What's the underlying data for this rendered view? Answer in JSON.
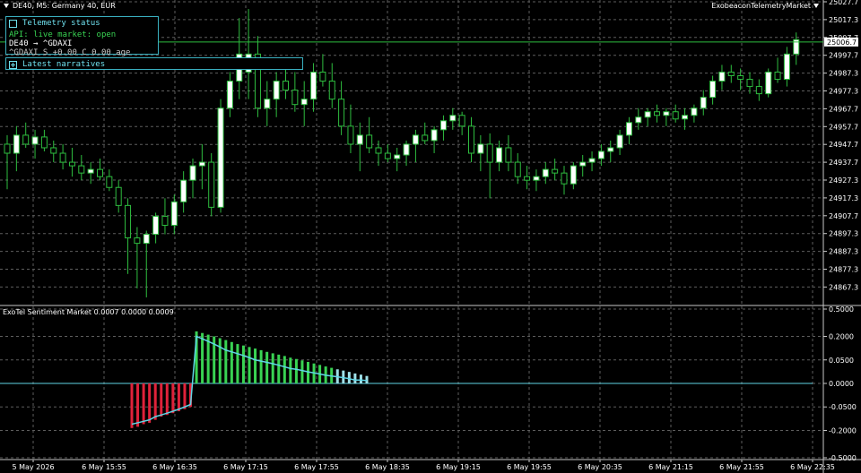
{
  "header": {
    "symbol_info": "DE40, M5:  Germany 40, EUR",
    "indicator_name": "ExobeaconTelemetryMarket"
  },
  "status_panel": {
    "title": "Telemetry status",
    "api_line": "API: live  market: open",
    "symbol_line": "DE40 → ^GDAXI",
    "quote_line": "^GDAXI S +0.00  C 0.00  age 5h49m"
  },
  "narratives_panel": {
    "title": "Latest narratives"
  },
  "price_axis": {
    "ticks": [
      "25027.7",
      "25017.3",
      "25007.7",
      "24997.7",
      "24987.3",
      "24977.3",
      "24967.7",
      "24957.7",
      "24947.7",
      "24937.7",
      "24927.3",
      "24917.3",
      "24907.7",
      "24897.3",
      "24887.3",
      "24877.3",
      "24867.3"
    ],
    "current_price": "25006.7"
  },
  "indicator": {
    "label": "ExoTel Sentiment Market 0.0007 0.0000 0.0009",
    "ticks": [
      "0.5000",
      "0.2000",
      "0.0500",
      "0.0000",
      "-0.0500",
      "-0.2000",
      "-0.5000"
    ]
  },
  "time_axis": {
    "labels": [
      "5 May 2026",
      "6 May 15:55",
      "6 May 16:35",
      "6 May 17:15",
      "6 May 17:55",
      "6 May 18:35",
      "6 May 19:15",
      "6 May 19:55",
      "6 May 20:35",
      "6 May 21:15",
      "6 May 21:55",
      "6 May 22:35"
    ]
  },
  "colors": {
    "bull_body": "#ffffff",
    "bear_body": "#000000",
    "wick": "#2ebd3f",
    "grid": "#5e5e5e",
    "hist_pos": "#39d353",
    "hist_neg": "#e0223a",
    "hist_pale": "#9fe0e8",
    "signal_line": "#5fd6e6",
    "price_line": "#2ebd3f"
  },
  "chart_data": [
    {
      "type": "candlestick",
      "title": "DE40, M5:  Germany 40, EUR",
      "ylim": [
        24862.0,
        25030.0
      ],
      "current_price": 25006.7,
      "candles": [
        [
          24950,
          24955,
          24925,
          24945
        ],
        [
          24945,
          24960,
          24935,
          24955
        ],
        [
          24955,
          24962,
          24948,
          24950
        ],
        [
          24950,
          24958,
          24942,
          24954
        ],
        [
          24954,
          24958,
          24946,
          24948
        ],
        [
          24948,
          24952,
          24940,
          24945
        ],
        [
          24945,
          24950,
          24936,
          24940
        ],
        [
          24940,
          24948,
          24932,
          24938
        ],
        [
          24938,
          24944,
          24930,
          24934
        ],
        [
          24934,
          24940,
          24928,
          24936
        ],
        [
          24936,
          24942,
          24930,
          24932
        ],
        [
          24932,
          24936,
          24924,
          24926
        ],
        [
          24926,
          24930,
          24912,
          24916
        ],
        [
          24916,
          24920,
          24878,
          24898
        ],
        [
          24898,
          24904,
          24870,
          24895
        ],
        [
          24895,
          24902,
          24865,
          24900
        ],
        [
          24900,
          24912,
          24895,
          24910
        ],
        [
          24910,
          24920,
          24900,
          24905
        ],
        [
          24905,
          24922,
          24900,
          24918
        ],
        [
          24918,
          24935,
          24912,
          24930
        ],
        [
          24930,
          24942,
          24920,
          24938
        ],
        [
          24938,
          24950,
          24925,
          24940
        ],
        [
          24940,
          24945,
          24910,
          24915
        ],
        [
          24915,
          24975,
          24912,
          24970
        ],
        [
          24970,
          24990,
          24965,
          24985
        ],
        [
          24985,
          25020,
          24975,
          25000
        ],
        [
          24990,
          25025,
          24975,
          25000
        ],
        [
          25000,
          25010,
          24965,
          24970
        ],
        [
          24970,
          24985,
          24960,
          24975
        ],
        [
          24975,
          24990,
          24965,
          24985
        ],
        [
          24985,
          24995,
          24975,
          24980
        ],
        [
          24980,
          24990,
          24968,
          24972
        ],
        [
          24972,
          24985,
          24960,
          24975
        ],
        [
          24975,
          24995,
          24968,
          24990
        ],
        [
          24990,
          25000,
          24982,
          24985
        ],
        [
          24985,
          24995,
          24970,
          24975
        ],
        [
          24975,
          24985,
          24955,
          24960
        ],
        [
          24960,
          24972,
          24945,
          24950
        ],
        [
          24950,
          24962,
          24935,
          24955
        ],
        [
          24955,
          24965,
          24945,
          24948
        ],
        [
          24948,
          24952,
          24938,
          24945
        ],
        [
          24945,
          24950,
          24940,
          24942
        ],
        [
          24942,
          24948,
          24935,
          24944
        ],
        [
          24944,
          24952,
          24938,
          24950
        ],
        [
          24950,
          24958,
          24940,
          24955
        ],
        [
          24955,
          24962,
          24950,
          24952
        ],
        [
          24952,
          24960,
          24945,
          24958
        ],
        [
          24958,
          24966,
          24952,
          24963
        ],
        [
          24963,
          24970,
          24958,
          24966
        ],
        [
          24966,
          24968,
          24955,
          24960
        ],
        [
          24960,
          24965,
          24940,
          24945
        ],
        [
          24945,
          24955,
          24935,
          24950
        ],
        [
          24950,
          24956,
          24920,
          24940
        ],
        [
          24940,
          24952,
          24935,
          24948
        ],
        [
          24948,
          24955,
          24935,
          24940
        ],
        [
          24940,
          24945,
          24928,
          24932
        ],
        [
          24932,
          24938,
          24925,
          24930
        ],
        [
          24930,
          24936,
          24924,
          24932
        ],
        [
          24932,
          24940,
          24928,
          24936
        ],
        [
          24936,
          24942,
          24930,
          24934
        ],
        [
          24934,
          24938,
          24922,
          24928
        ],
        [
          24928,
          24940,
          24925,
          24938
        ],
        [
          24938,
          24944,
          24932,
          24940
        ],
        [
          24940,
          24946,
          24935,
          24942
        ],
        [
          24942,
          24950,
          24938,
          24946
        ],
        [
          24946,
          24952,
          24940,
          24948
        ],
        [
          24948,
          24958,
          24944,
          24955
        ],
        [
          24955,
          24965,
          24950,
          24962
        ],
        [
          24962,
          24970,
          24958,
          24965
        ],
        [
          24965,
          24970,
          24960,
          24968
        ],
        [
          24968,
          24972,
          24962,
          24966
        ],
        [
          24966,
          24970,
          24960,
          24968
        ],
        [
          24968,
          24972,
          24962,
          24964
        ],
        [
          24964,
          24970,
          24958,
          24966
        ],
        [
          24966,
          24972,
          24962,
          24970
        ],
        [
          24970,
          24980,
          24966,
          24976
        ],
        [
          24976,
          24988,
          24972,
          24985
        ],
        [
          24985,
          24994,
          24980,
          24990
        ],
        [
          24990,
          24994,
          24984,
          24988
        ],
        [
          24988,
          24992,
          24980,
          24986
        ],
        [
          24986,
          24990,
          24978,
          24982
        ],
        [
          24982,
          24986,
          24974,
          24978
        ],
        [
          24978,
          24992,
          24976,
          24990
        ],
        [
          24990,
          24998,
          24984,
          24986
        ],
        [
          24986,
          25004,
          24982,
          25000
        ],
        [
          25000,
          25012,
          24994,
          25008
        ]
      ]
    },
    {
      "type": "bar",
      "title": "ExoTel Sentiment Market 0.0007 0.0000 0.0009",
      "ylim": [
        -0.5,
        0.5
      ],
      "values": [
        -0.18,
        -0.17,
        -0.15,
        -0.14,
        -0.12,
        -0.1,
        -0.09,
        -0.08,
        -0.07,
        -0.06,
        -0.05,
        0.245,
        0.23,
        0.215,
        0.2,
        0.185,
        0.17,
        0.155,
        0.14,
        0.13,
        0.12,
        0.11,
        0.1,
        0.09,
        0.082,
        0.075,
        0.068,
        0.06,
        0.054,
        0.048,
        0.042,
        0.036,
        0.031,
        0.026,
        0.022,
        0.018,
        0.015,
        0.012,
        0.009,
        0.007,
        0.005
      ],
      "signal": [
        -0.15,
        -0.14,
        -0.13,
        -0.12,
        -0.1,
        -0.09,
        -0.08,
        -0.07,
        -0.06,
        -0.05,
        -0.04,
        0.2,
        0.18,
        0.16,
        0.14,
        0.12,
        0.1,
        0.09,
        0.08,
        0.07,
        0.06,
        0.05,
        0.045,
        0.04,
        0.035,
        0.03,
        0.025,
        0.02,
        0.018,
        0.015,
        0.012,
        0.01,
        0.008,
        0.006,
        0.005,
        0.004,
        0.003,
        0.002,
        0.001,
        0.001,
        0.0007
      ]
    }
  ]
}
